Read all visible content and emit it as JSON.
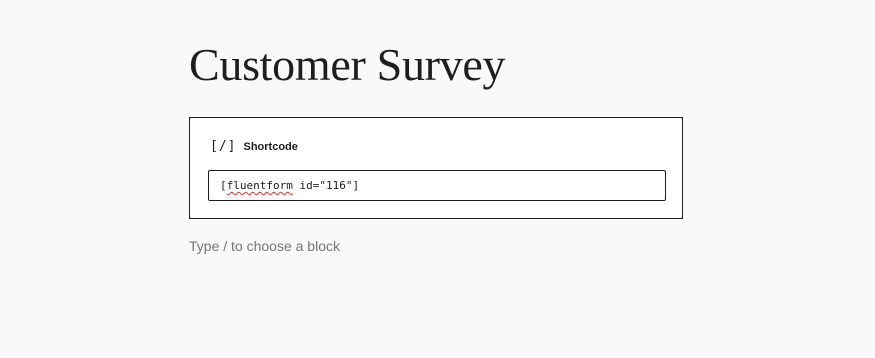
{
  "post": {
    "title": "Customer Survey"
  },
  "shortcode_block": {
    "icon": "[/]",
    "label": "Shortcode",
    "input": {
      "value_prefix": "[",
      "value_word": "fluentform",
      "value_suffix": " id=\"116\"]"
    }
  },
  "appender": {
    "placeholder": "Type / to choose a block"
  }
}
